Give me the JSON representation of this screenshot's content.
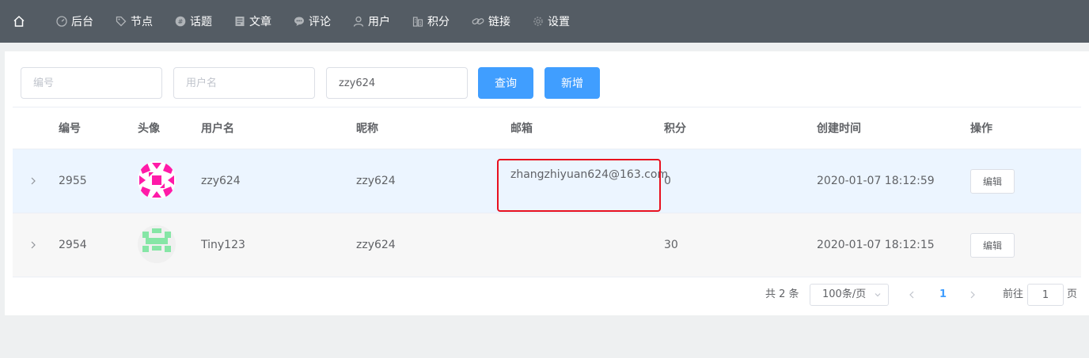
{
  "nav": {
    "home_icon": "home-icon",
    "items": [
      {
        "label": "后台",
        "icon": "dashboard-icon"
      },
      {
        "label": "节点",
        "icon": "tag-icon"
      },
      {
        "label": "话题",
        "icon": "topic-icon"
      },
      {
        "label": "文章",
        "icon": "document-icon"
      },
      {
        "label": "评论",
        "icon": "comment-icon"
      },
      {
        "label": "用户",
        "icon": "user-icon"
      },
      {
        "label": "积分",
        "icon": "score-icon"
      },
      {
        "label": "链接",
        "icon": "link-icon"
      },
      {
        "label": "设置",
        "icon": "gear-icon"
      }
    ]
  },
  "filters": {
    "id_placeholder": "编号",
    "username_placeholder": "用户名",
    "email_value": "zzy624",
    "query_label": "查询",
    "add_label": "新增"
  },
  "table": {
    "headers": {
      "id": "编号",
      "avatar": "头像",
      "username": "用户名",
      "nickname": "昵称",
      "email": "邮箱",
      "score": "积分",
      "created": "创建时间",
      "actions": "操作"
    },
    "rows": [
      {
        "id": "2955",
        "username": "zzy624",
        "nickname": "zzy624",
        "email": "zhangzhiyuan624@163.com",
        "score": "0",
        "created": "2020-01-07 18:12:59",
        "edit": "编辑"
      },
      {
        "id": "2954",
        "username": "Tiny123",
        "nickname": "zzy624",
        "email": "",
        "score": "30",
        "created": "2020-01-07 18:12:15",
        "edit": "编辑"
      }
    ]
  },
  "pagination": {
    "total": "共 2 条",
    "page_size": "100条/页",
    "current_page": "1",
    "goto_label": "前往",
    "goto_value": "1",
    "page_suffix": "页"
  },
  "colors": {
    "nav_bg": "#545c64",
    "primary": "#409eff",
    "highlight_row": "#ecf5ff",
    "annotation_box": "#e8101f",
    "avatar1": "#ff1aa8",
    "avatar2": "#86e6a6"
  }
}
